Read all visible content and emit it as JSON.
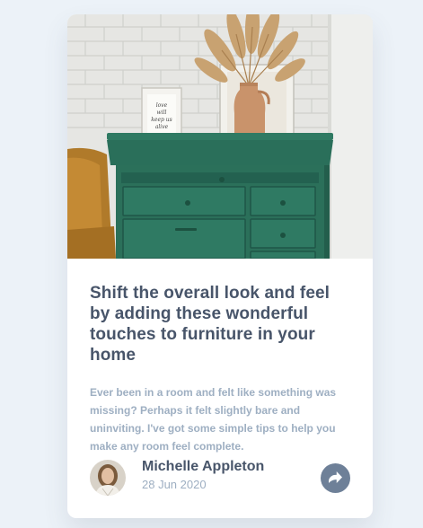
{
  "card": {
    "title": "Shift the overall look and feel by adding these wonderful touches to furniture in your home",
    "description": "Ever been in a room and felt like something was missing? Perhaps it felt slightly bare and uninviting. I've got some simple tips to help you make any room feel complete.",
    "author": {
      "name": "Michelle Appleton",
      "date": "28 Jun 2020"
    },
    "share_icon": "share-arrow-icon"
  },
  "image": {
    "frame_text": [
      "love",
      "will",
      "keep us",
      "alive"
    ]
  },
  "colors": {
    "background": "#ecf2f8",
    "title": "#48556a",
    "muted": "#9eafc2",
    "share_button": "#6e8098",
    "card": "#ffffff"
  }
}
